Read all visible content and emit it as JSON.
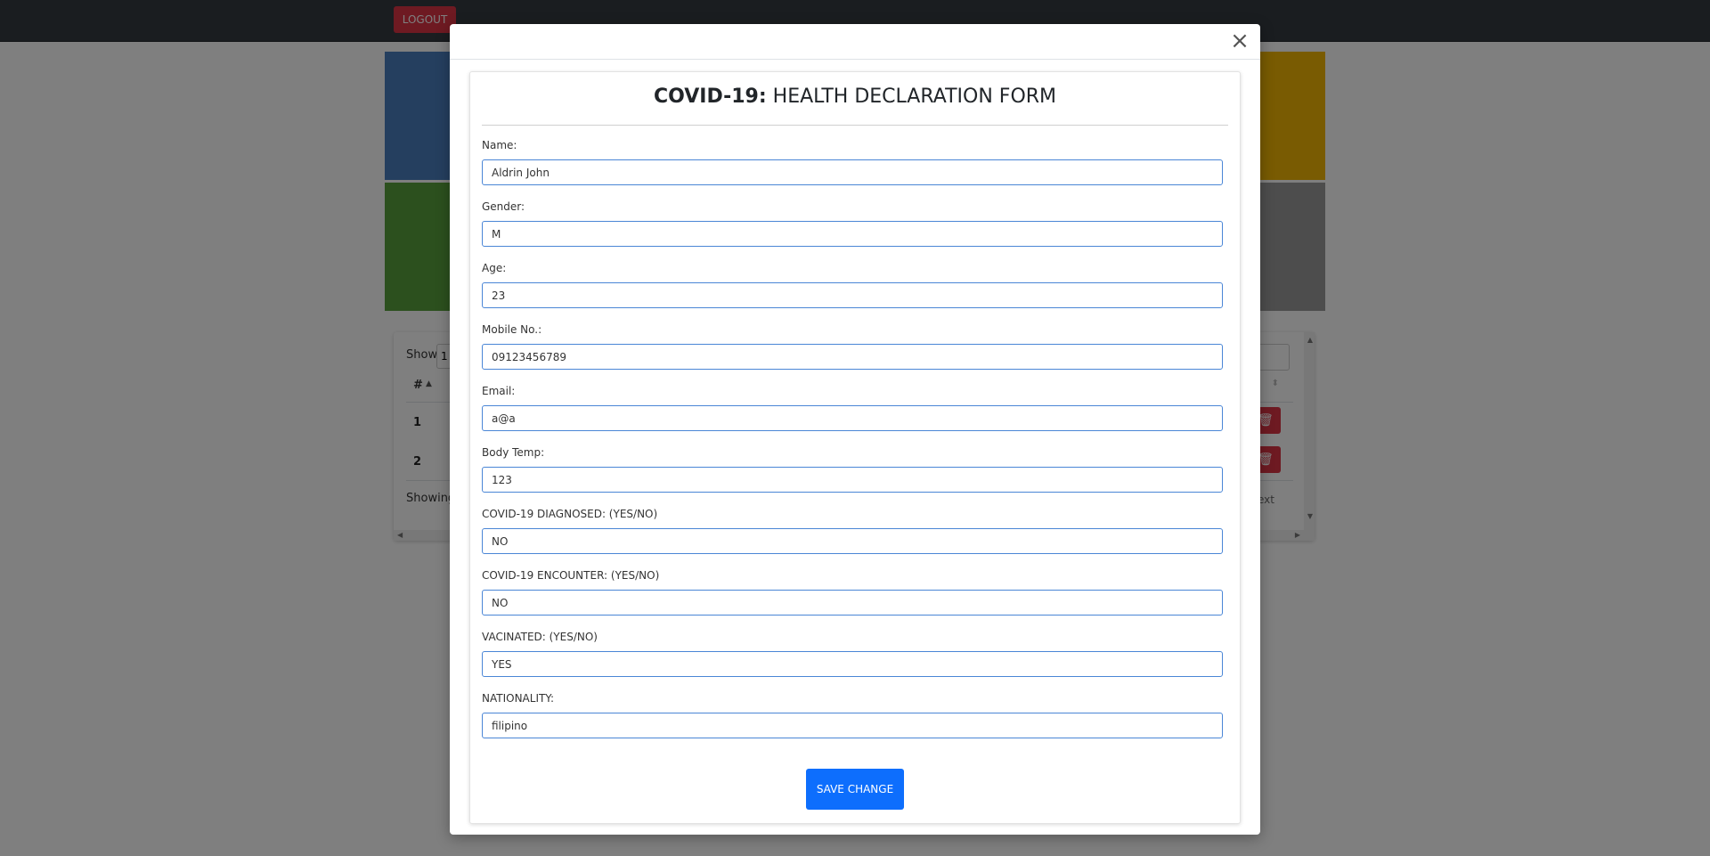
{
  "topbar": {
    "logout_label": "LOGOUT"
  },
  "table": {
    "show_label": "Show",
    "show_value": "1",
    "hash_header": "#",
    "rows": [
      {
        "num": "1"
      },
      {
        "num": "2"
      }
    ],
    "showing_text": "Showing",
    "next_text": "ext"
  },
  "modal": {
    "close_glyph": "×",
    "form": {
      "title_bold": "COVID-19:",
      "title_rest": " HEALTH DECLARATION FORM",
      "fields": [
        {
          "label": "Name:",
          "value": "Aldrin John"
        },
        {
          "label": "Gender:",
          "value": "M"
        },
        {
          "label": "Age:",
          "value": "23"
        },
        {
          "label": "Mobile No.:",
          "value": "09123456789"
        },
        {
          "label": "Email:",
          "value": "a@a"
        },
        {
          "label": "Body Temp:",
          "value": "123"
        },
        {
          "label": "COVID-19 DIAGNOSED: (YES/NO)",
          "value": "NO"
        },
        {
          "label": "COVID-19 ENCOUNTER: (YES/NO)",
          "value": "NO"
        },
        {
          "label": "VACINATED: (YES/NO)",
          "value": "YES"
        },
        {
          "label": "NATIONALITY:",
          "value": "filipino"
        }
      ],
      "save_label": "SAVE CHANGE"
    }
  },
  "icons": {
    "close": "close-icon",
    "trash": "trash-icon"
  },
  "colors": {
    "accent": "#0d6efd",
    "danger": "#dc3545",
    "topbar": "#343a40",
    "tile_blue": "#4a7fbf",
    "tile_green": "#58a03c",
    "tile_yellow": "#f2b705",
    "tile_gray": "#9b9b9b"
  }
}
